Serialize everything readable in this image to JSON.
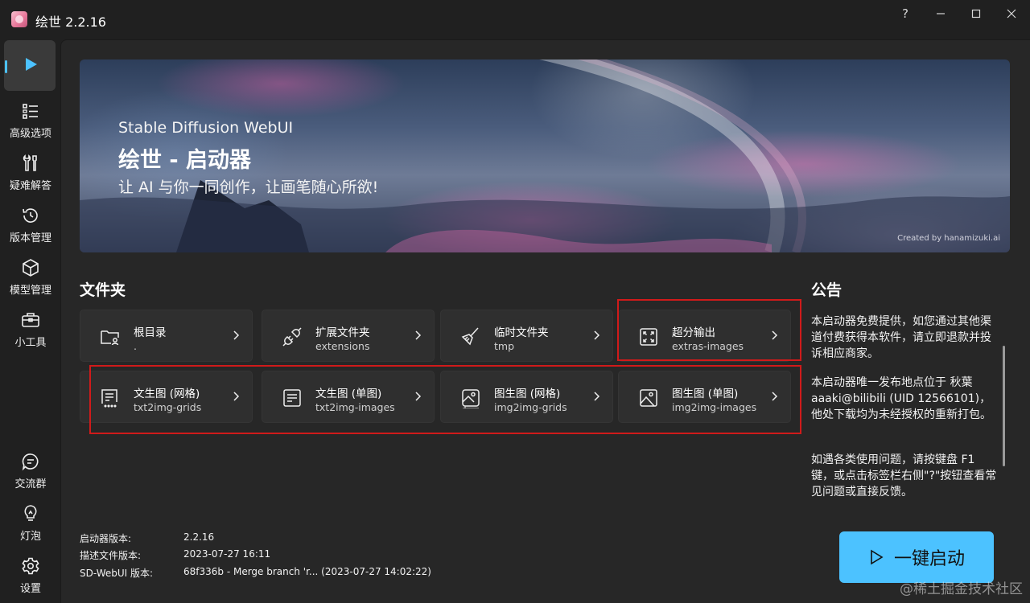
{
  "window": {
    "title": "绘世 2.2.16",
    "controls": {
      "help": "?",
      "minimize": "—",
      "maximize": "☐",
      "close": "✕"
    }
  },
  "sidebar": {
    "items": [
      {
        "label": "",
        "icon": "play-icon",
        "active": true
      },
      {
        "label": "高级选项",
        "icon": "list-icon"
      },
      {
        "label": "疑难解答",
        "icon": "wrench-icon"
      },
      {
        "label": "版本管理",
        "icon": "history-icon"
      },
      {
        "label": "模型管理",
        "icon": "cube-icon"
      },
      {
        "label": "小工具",
        "icon": "toolbox-icon"
      }
    ],
    "bottom_items": [
      {
        "label": "交流群",
        "icon": "chat-icon"
      },
      {
        "label": "灯泡",
        "icon": "lightbulb-icon"
      },
      {
        "label": "设置",
        "icon": "gear-icon"
      }
    ]
  },
  "hero": {
    "subtitle": "Stable Diffusion WebUI",
    "title": "绘世 - 启动器",
    "slogan": "让 AI 与你一同创作，让画笔随心所欲!",
    "credit": "Created by hanamizuki.ai"
  },
  "folders": {
    "title": "文件夹",
    "items": [
      {
        "name": "根目录",
        "path": ".",
        "icon": "folder-user-icon"
      },
      {
        "name": "扩展文件夹",
        "path": "extensions",
        "icon": "plug-icon"
      },
      {
        "name": "临时文件夹",
        "path": "tmp",
        "icon": "broom-icon"
      },
      {
        "name": "超分输出",
        "path": "extras-images",
        "icon": "upscale-icon"
      },
      {
        "name": "文生图 (网格)",
        "path": "txt2img-grids",
        "icon": "text-grid-icon"
      },
      {
        "name": "文生图 (单图)",
        "path": "txt2img-images",
        "icon": "text-image-icon"
      },
      {
        "name": "图生图 (网格)",
        "path": "img2img-grids",
        "icon": "image-grid-icon"
      },
      {
        "name": "图生图 (单图)",
        "path": "img2img-images",
        "icon": "image-icon"
      }
    ]
  },
  "notice": {
    "title": "公告",
    "paragraphs": [
      "本启动器免费提供，如您通过其他渠道付费获得本软件，请立即退款并投诉相应商家。",
      "本启动器唯一发布地点位于 秋葉aaaki@bilibili (UID 12566101)，他处下载均为未经授权的重新打包。",
      "如遇各类使用问题，请按键盘 F1 键，或点击标签栏右侧\"?\"按钮查看常见问题或直接反馈。"
    ]
  },
  "version_info": [
    {
      "label": "启动器版本:",
      "value": "2.2.16"
    },
    {
      "label": "描述文件版本:",
      "value": "2023-07-27 16:11"
    },
    {
      "label": "SD-WebUI 版本:",
      "value": "68f336b - Merge branch 'r... (2023-07-27 14:02:22)"
    }
  ],
  "launch_button": {
    "label": "一键启动",
    "icon": "play-outline-icon"
  },
  "watermark": "@稀土掘金技术社区",
  "colors": {
    "accent": "#4cc2ff",
    "highlight_border": "#d01a1a",
    "background": "#202020",
    "panel": "#272727",
    "card": "#2f2f2f"
  }
}
